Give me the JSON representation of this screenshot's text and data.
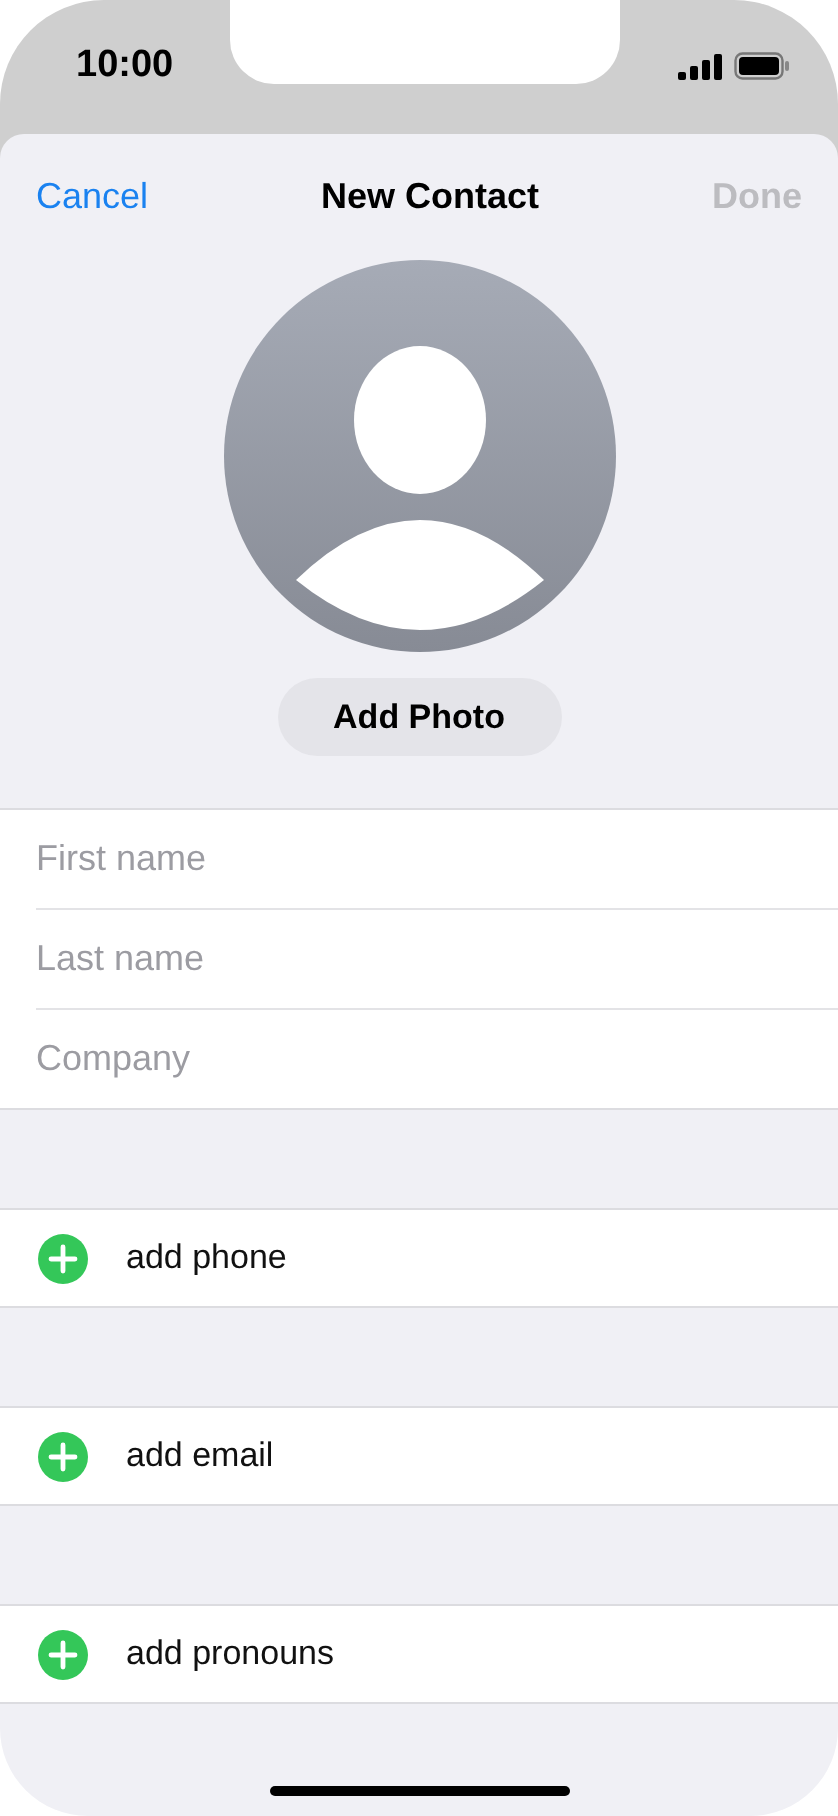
{
  "status_bar": {
    "time": "10:00"
  },
  "nav": {
    "cancel": "Cancel",
    "title": "New Contact",
    "done": {
      "label": "Done",
      "disabled": true
    }
  },
  "photo": {
    "button": "Add Photo"
  },
  "fields": [
    {
      "placeholder": "First name"
    },
    {
      "placeholder": "Last name"
    },
    {
      "placeholder": "Company"
    }
  ],
  "add_rows": [
    {
      "label": "add phone"
    },
    {
      "label": "add email"
    },
    {
      "label": "add pronouns"
    }
  ]
}
